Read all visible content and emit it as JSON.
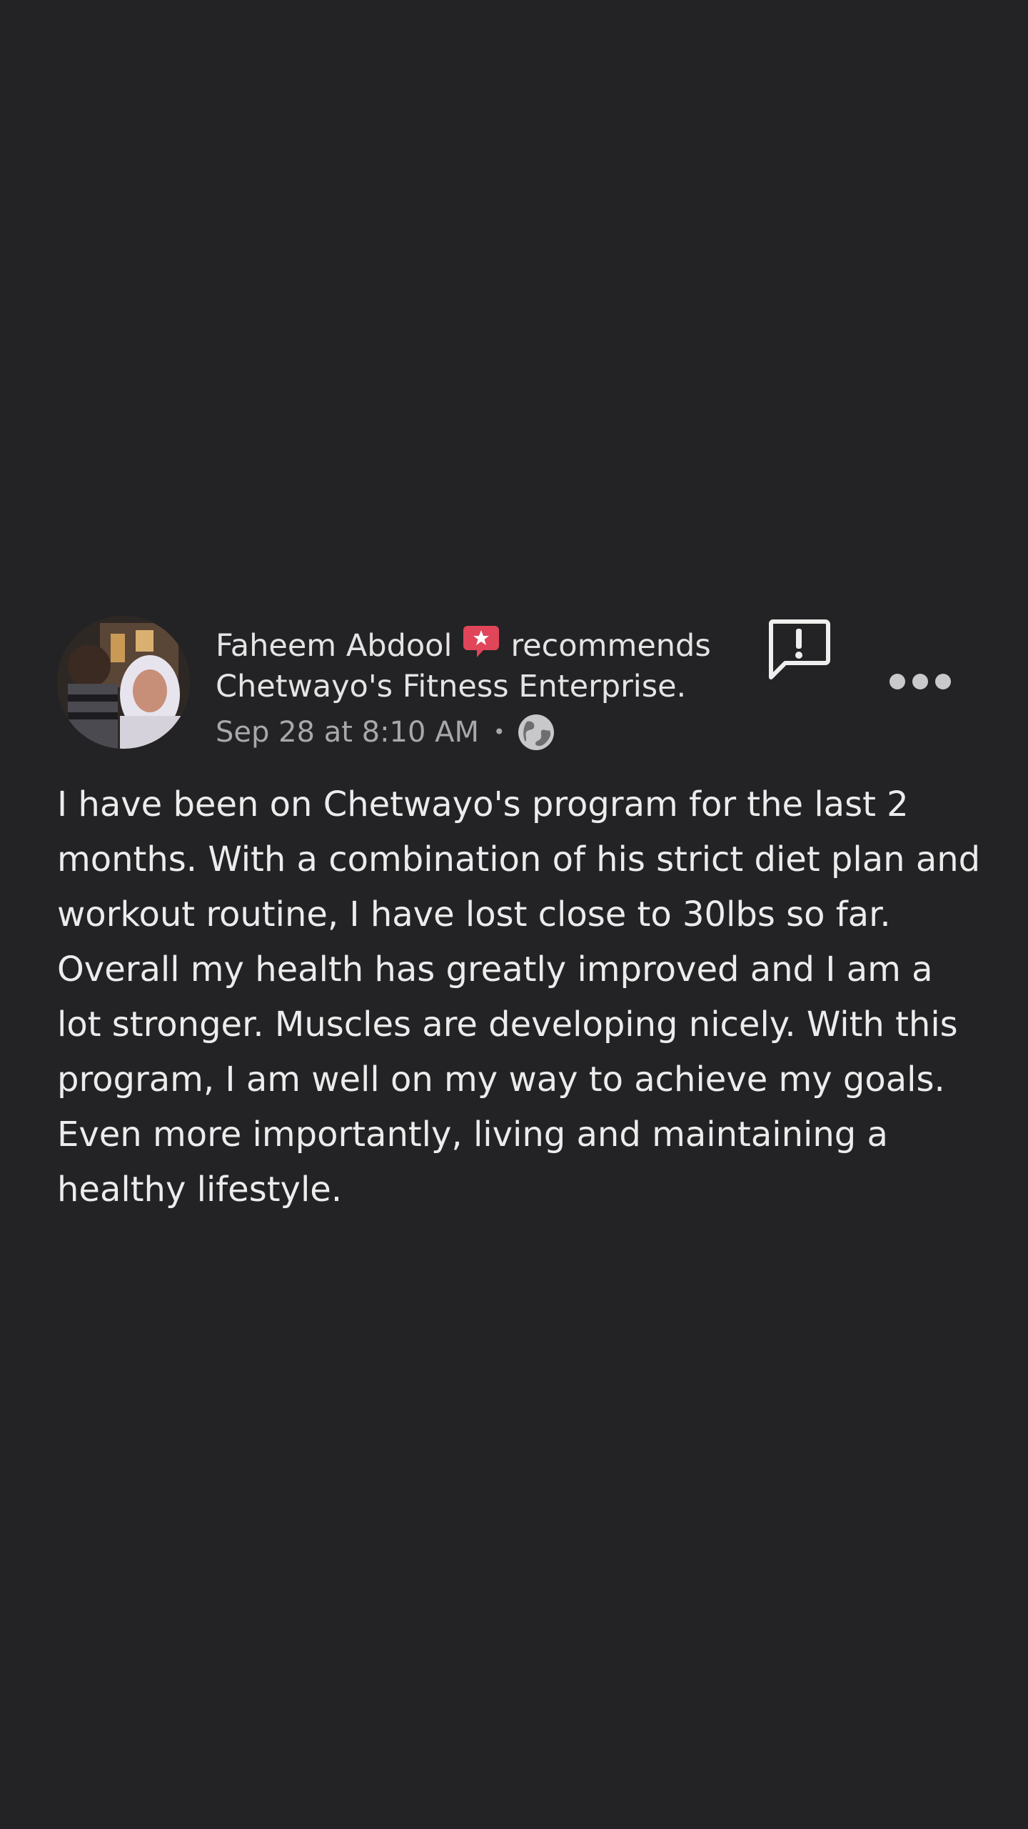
{
  "post": {
    "author": "Faheem Abdool",
    "action": "recommends",
    "page_name": "Chetwayo's Fitness Enterprise.",
    "timestamp": "Sep 28 at 8:10 AM",
    "separator": "•",
    "privacy_icon": "globe-icon",
    "recommend_icon": "recommend-star-bubble-icon",
    "report_icon": "report-exclamation-icon",
    "more_icon": "more-options-icon",
    "body": "I have been on Chetwayo's program for the last 2 months. With a combination of his strict diet plan and workout routine, I have lost close to 30lbs so far. Overall my health has greatly improved and I am a lot stronger. Muscles are developing nicely. With this program, I am well on my way to achieve my goals. Even more importantly, living and maintaining a healthy lifestyle."
  },
  "colors": {
    "background": "#232325",
    "text": "#ececec",
    "meta_text": "#a8a8aa",
    "recommend_accent": "#e0455a"
  }
}
